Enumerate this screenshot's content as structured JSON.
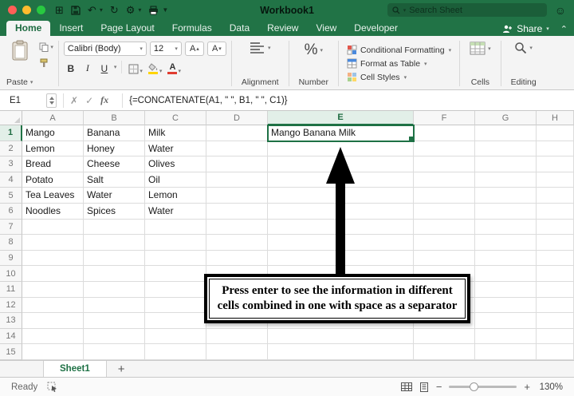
{
  "titlebar": {
    "title": "Workbook1",
    "search_placeholder": "Search Sheet"
  },
  "ribbon": {
    "tabs": [
      "Home",
      "Insert",
      "Page Layout",
      "Formulas",
      "Data",
      "Review",
      "View",
      "Developer"
    ],
    "active_tab": "Home",
    "share_label": "Share",
    "home": {
      "paste_label": "Paste",
      "font_name": "Calibri (Body)",
      "font_size": "12",
      "bold_label": "B",
      "italic_label": "I",
      "underline_label": "U",
      "alignment_label": "Alignment",
      "number_symbol": "%",
      "number_label": "Number",
      "styles": [
        "Conditional Formatting",
        "Format as Table",
        "Cell Styles"
      ],
      "cells_label": "Cells",
      "editing_label": "Editing"
    }
  },
  "formula_bar": {
    "name_box": "E1",
    "fx_label": "fx",
    "formula": "{=CONCATENATE(A1, \" \", B1, \" \", C1)}"
  },
  "grid": {
    "column_headers": [
      "A",
      "B",
      "C",
      "D",
      "E",
      "F",
      "G",
      "H"
    ],
    "row_count": 15,
    "selected_cell": "E1",
    "cells": {
      "A1": "Mango",
      "B1": "Banana",
      "C1": "Milk",
      "E1": "Mango Banana Milk",
      "A2": "Lemon",
      "B2": "Honey",
      "C2": "Water",
      "A3": "Bread",
      "B3": "Cheese",
      "C3": "Olives",
      "A4": "Potato",
      "B4": "Salt",
      "C4": "Oil",
      "A5": "Tea Leaves",
      "B5": "Water",
      "C5": "Lemon",
      "A6": "Noodles",
      "B6": "Spices",
      "C6": "Water"
    }
  },
  "annotation": {
    "text": "Press enter to see the information in different cells combined in one with space as a separator"
  },
  "sheet_bar": {
    "tabs": [
      "Sheet1"
    ],
    "add_label": "+"
  },
  "status_bar": {
    "ready_label": "Ready",
    "zoom_level": "130%"
  }
}
